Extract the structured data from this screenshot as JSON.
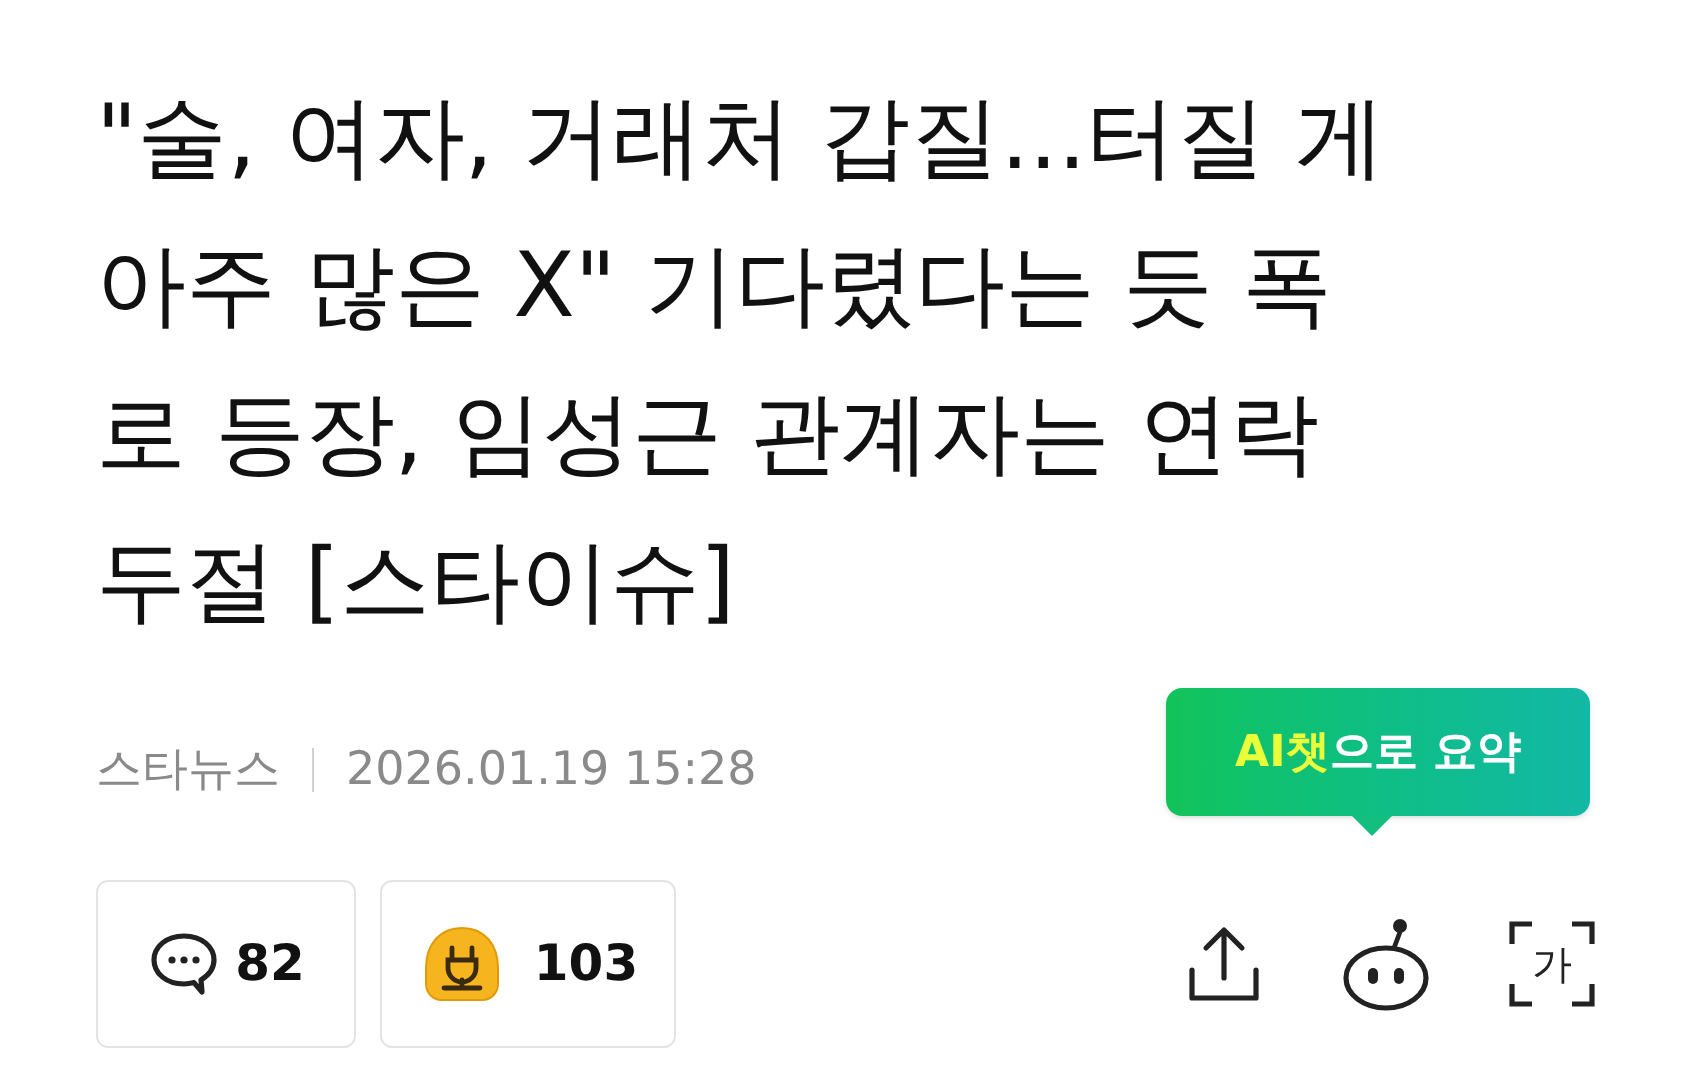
{
  "headline": {
    "lines": [
      "\"술, 여자, 거래처 갑질...터질 게",
      "아주 많은 X\" 기다렸다는 듯 폭",
      "로 등장, 임성근 관계자는 연락",
      "두절 [스타이슈]"
    ]
  },
  "meta": {
    "source": "스타뉴스",
    "datetime": "2026.01.19 15:28"
  },
  "ai_summary_tooltip": {
    "highlight": "AI챗",
    "text": "으로 요약"
  },
  "reactions": [
    {
      "kind": "comment",
      "count": "82"
    },
    {
      "kind": "reaction",
      "count": "103"
    }
  ],
  "actions": [
    {
      "kind": "share"
    },
    {
      "kind": "bot"
    },
    {
      "kind": "translate",
      "glyph": "가"
    }
  ]
}
